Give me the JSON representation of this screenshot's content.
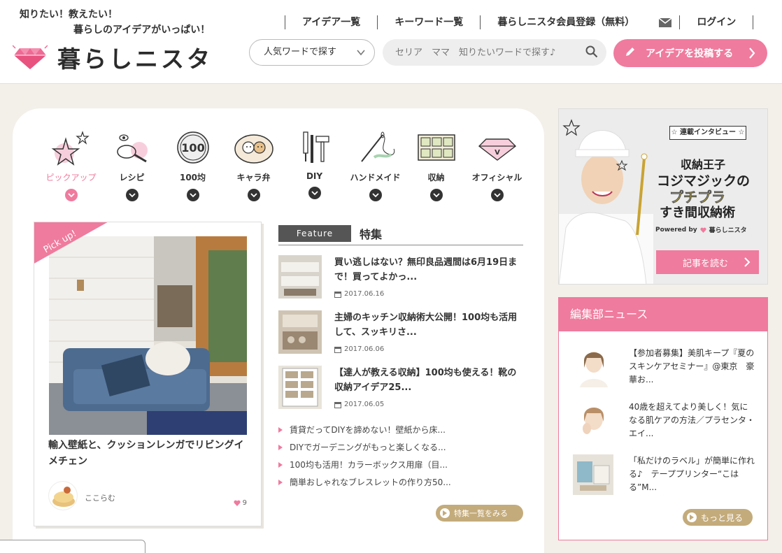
{
  "header": {
    "tagline_1": "知りたい！教えたい！",
    "tagline_2": "暮らしのアイデアがいっぱい！",
    "logo_text": "暮らしニスタ",
    "nav": [
      "アイデア一覧",
      "キーワード一覧",
      "暮らしニスタ会員登録（無料）",
      "ログイン"
    ],
    "search_select": "人気ワードで探す",
    "search_placeholder": "セリア　ママ　知りたいワードで探す♪",
    "post_button": "アイデアを投稿する",
    "icons": [
      "mail-icon",
      "search-icon",
      "pencil-icon"
    ]
  },
  "categories": [
    {
      "label": "ピックアップ",
      "icon": "star-icon",
      "active": true
    },
    {
      "label": "レシピ",
      "icon": "frying-pan-icon",
      "active": false
    },
    {
      "label": "100均",
      "icon": "coin-icon",
      "active": false
    },
    {
      "label": "キャラ弁",
      "icon": "bento-icon",
      "active": false
    },
    {
      "label": "DIY",
      "icon": "tools-icon",
      "active": false
    },
    {
      "label": "ハンドメイド",
      "icon": "needle-icon",
      "active": false
    },
    {
      "label": "収納",
      "icon": "storage-box-icon",
      "active": false
    },
    {
      "label": "オフィシャル",
      "icon": "diamond-icon",
      "active": false
    }
  ],
  "pickup": {
    "ribbon": "Pick up!",
    "title": "輸入壁紙と、クッションレンガでリビングイメチェン",
    "user": "ここらむ",
    "likes": "9"
  },
  "feature": {
    "badge": "Feature",
    "title": "特集",
    "items": [
      {
        "title": "買い逃しはない？無印良品週間は6月19日まで！買ってよかっ...",
        "date": "2017.06.16"
      },
      {
        "title": "主婦のキッチン収納術大公開！100均も活用して、スッキリさ...",
        "date": "2017.06.06"
      },
      {
        "title": "【達人が教える収納】100均も使える！靴の収納アイデア25...",
        "date": "2017.06.05"
      }
    ],
    "links": [
      "賃貸だってDIYを諦めない！壁紙から床...",
      "DIYでガーデニングがもっと楽しくなる...",
      "100均も活用！カラーボックス用扉（目...",
      "簡単おしゃれなブレスレットの作り方50..."
    ],
    "more": "特集一覧をみる"
  },
  "banner": {
    "tag": "☆ 連載インタビュー ☆",
    "line1": "収納王子",
    "line2": "コジマジックの",
    "line3": "プチプラ",
    "line4": "すき間収納術",
    "powered": "Powered by",
    "powered_brand": "暮らしニスタ",
    "read_button": "記事を読む"
  },
  "news": {
    "title": "編集部ニュース",
    "items": [
      {
        "text": "【参加者募集】美肌キープ『夏のスキンケアセミナー』@東京　豪華お..."
      },
      {
        "text": "40歳を超えてより美しく！気になる肌ケアの方法／プラセンタ・エイ..."
      },
      {
        "text": "「私だけのラベル」が簡単に作れる♪　テーププリンター“こはる”M..."
      }
    ],
    "more": "もっと見る"
  },
  "colors": {
    "accent": "#ef7b9e",
    "gold": "#c4ab7b",
    "background": "#f3efe9"
  }
}
